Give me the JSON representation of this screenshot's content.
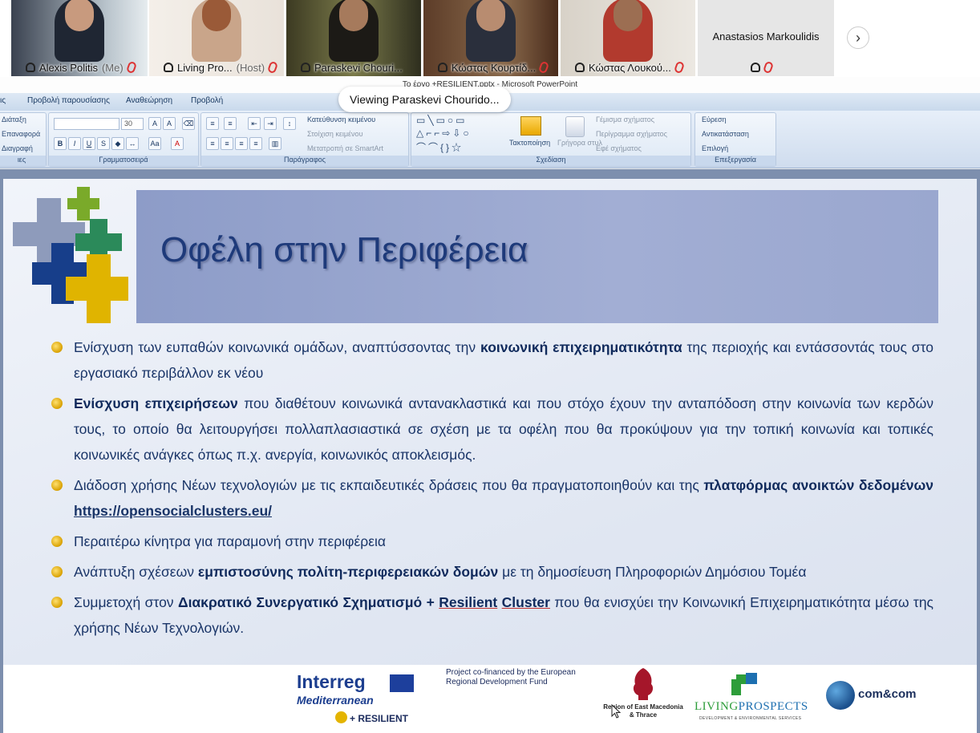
{
  "participants": [
    {
      "name": "Alexis Politis",
      "role": "(Me)"
    },
    {
      "name": "Living Pro...",
      "role": "(Host)"
    },
    {
      "name": "Paraskevi Chouri...",
      "role": ""
    },
    {
      "name": "Κώστας Κουρτίδ...",
      "role": ""
    },
    {
      "name": "Κώστας Λουκού...",
      "role": ""
    },
    {
      "name": "Anastasios Markoulidis",
      "role": ""
    }
  ],
  "window_title": "Το έργο +RESILIENT.pptx - Microsoft PowerPoint",
  "viewing_toast": "Viewing Paraskevi Chourido...",
  "ribbon": {
    "tabs": [
      "Προβολή παρουσίασης",
      "Αναθεώρηση",
      "Προβολή"
    ],
    "slides_group": {
      "layout": "Διάταξη",
      "reset": "Επαναφορά",
      "delete": "Διαγραφή",
      "label": "ιες"
    },
    "font_group": {
      "size": "30",
      "label": "Γραμματοσειρά"
    },
    "paragraph_group": {
      "text_direction": "Κατεύθυνση κειμένου",
      "align_text": "Στοίχιση κειμένου",
      "smartart": "Μετατροπή σε SmartArt",
      "label": "Παράγραφος"
    },
    "drawing_group": {
      "arrange": "Τακτοποίηση",
      "quick_styles": "Γρήγορα στυλ",
      "shape_fill": "Γέμισμα σχήματος",
      "shape_outline": "Περίγραμμα σχήματος",
      "shape_effects": "Εφέ σχήματος",
      "label": "Σχεδίαση"
    },
    "editing_group": {
      "find": "Εύρεση",
      "replace": "Αντικατάσταση",
      "select": "Επιλογή",
      "label": "Επεξεργασία"
    }
  },
  "slide": {
    "title": "Οφέλη στην Περιφέρεια",
    "bullets": {
      "b1": {
        "t1": "Ενίσχυση των ευπαθών κοινωνικά ομάδων, αναπτύσσοντας την ",
        "bold1": "κοινωνική επιχειρηματικότητα",
        "t2": " της περιοχής και εντάσσοντάς τους στο εργασιακό περιβάλλον εκ νέου"
      },
      "b2": {
        "bold1": "Ενίσχυση επιχειρήσεων",
        "t1": " που διαθέτουν κοινωνικά αντανακλαστικά και που στόχο έχουν την ανταπόδοση στην κοινωνία  των κερδών τους, το  οποίο   θα λειτουργήσει πολλαπλασιαστικά σε σχέση με τα οφέλη που θα προκύψουν για την τοπική κοινωνία και τοπικές κοινωνικές ανάγκες όπως π.χ. ανεργία, κοινωνικός αποκλεισμός."
      },
      "b3": {
        "t1": "Διάδοση χρήσης Νέων τεχνολογιών με τις εκπαιδευτικές δράσεις που θα πραγματοποιηθούν και της ",
        "bold1": "πλατφόρμας ανοικτών δεδομένων",
        "link": "https://opensocialclusters.eu/"
      },
      "b4": {
        "t1": "Περαιτέρω κίνητρα για παραμονή στην περιφέρεια"
      },
      "b5": {
        "t1": "Ανάπτυξη σχέσεων ",
        "bold1": "εμπιστοσύνης πολίτη-περιφερειακών δομών",
        "t2": " με τη δημοσίευση Πληροφοριών Δημόσιου Τομέα"
      },
      "b6": {
        "t1": "Συμμετοχή στον ",
        "bold1": "Διακρατικό Συνεργατικό Σχηματισμό + ",
        "bold2": "Resilient",
        "bold3": "Cluster",
        "t2": " που θα ενισχύει την Κοινωνική Επιχειρηματικότητα μέσω της χρήσης Νέων Τεχνολογιών."
      }
    },
    "footer": {
      "interreg": "Interreg",
      "mediterranean": "Mediterranean",
      "resilient": "+ RESILIENT",
      "cofinance": "Project co-financed by the European Regional Development Fund",
      "region": "Region of East Macedonia & Thrace",
      "living_a": "LIVING",
      "living_b": "PROSPECTS",
      "living_sub": "DEVELOPMENT & ENVIRONMENTAL SERVICES",
      "comcom": "com&com"
    }
  },
  "colors": {
    "accent_active_tile": "#2bb5e6",
    "title_text": "#1e3a7a",
    "body_text": "#1a3568",
    "title_band": "#9aa7cf"
  }
}
